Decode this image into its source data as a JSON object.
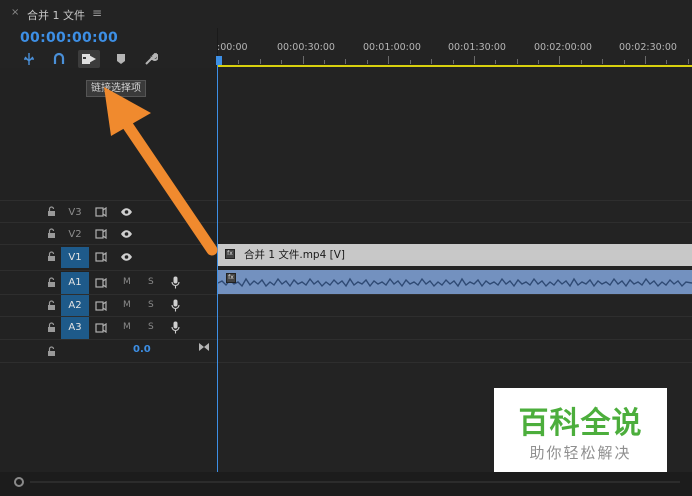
{
  "tab": {
    "close": "×",
    "title": "合并 1 文件",
    "menu": "≡"
  },
  "timecode": "00:00:00:00",
  "tools": [
    {
      "icon": "snap-icon",
      "glyph": "⚓"
    },
    {
      "icon": "magnet-icon",
      "glyph": "∩"
    },
    {
      "icon": "linked-selection-icon",
      "glyph": "▶"
    },
    {
      "icon": "marker-icon",
      "glyph": "◆"
    },
    {
      "icon": "wrench-icon",
      "glyph": "🔧"
    }
  ],
  "tooltip": "链接选择项",
  "ruler_labels": [
    ":00:00",
    "00:00:30:00",
    "00:01:00:00",
    "00:01:30:00",
    "00:02:00:00",
    "00:02:30:00"
  ],
  "tracks": {
    "video": [
      {
        "label": "V3",
        "targeted": false
      },
      {
        "label": "V2",
        "targeted": false
      },
      {
        "label": "V1",
        "targeted": true
      }
    ],
    "audio": [
      {
        "label": "A1",
        "targeted": true,
        "m": "M",
        "s": "S"
      },
      {
        "label": "A2",
        "targeted": true,
        "m": "M",
        "s": "S"
      },
      {
        "label": "A3",
        "targeted": true,
        "m": "M",
        "s": "S"
      }
    ]
  },
  "master": {
    "value": "0.0"
  },
  "clips": {
    "video_fx": "fx",
    "video_name": "合并 1 文件.mp4 [V]",
    "audio_fx": "fx"
  },
  "watermark": {
    "title": "百科全说",
    "subtitle": "助你轻松解决"
  },
  "colors": {
    "accent": "#3d8fe5",
    "target": "#1e5a8a",
    "work_area": "#d8d00e",
    "audio_clip": "#7391bf",
    "video_clip": "#c8c8c8",
    "arrow": "#f08a2e",
    "watermark_green": "#4cae3c"
  }
}
